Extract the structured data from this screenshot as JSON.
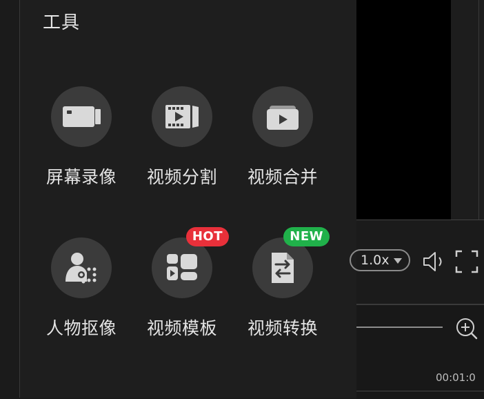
{
  "panel": {
    "title": "工具"
  },
  "tools": [
    {
      "name": "screen-record",
      "label": "屏幕录像",
      "icon": "camera-icon"
    },
    {
      "name": "video-split",
      "label": "视频分割",
      "icon": "film-split-icon"
    },
    {
      "name": "video-merge",
      "label": "视频合并",
      "icon": "stacked-play-icon"
    },
    {
      "name": "portrait-cutout",
      "label": "人物抠像",
      "icon": "person-cutout-icon"
    },
    {
      "name": "video-template",
      "label": "视频模板",
      "icon": "template-grid-icon",
      "badge": "HOT",
      "badge_color": "#e8303a"
    },
    {
      "name": "video-convert",
      "label": "视频转换",
      "icon": "file-swap-icon",
      "badge": "NEW",
      "badge_color": "#20b14a"
    }
  ],
  "player": {
    "speed": "1.0x",
    "time_text": "00:01:0"
  }
}
